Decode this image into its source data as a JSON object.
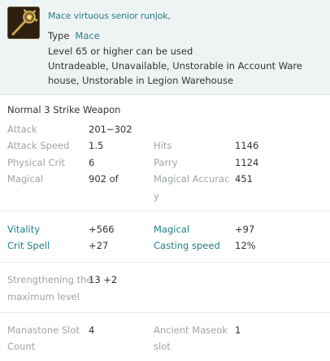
{
  "item": {
    "name": "Mace virtuous senior runjok,",
    "icon": "mace-icon",
    "type_label": "Type",
    "type_value": "Mace",
    "level_req": "Level 65 or higher can be used",
    "restrictions_line1": "Untradeable, Unavailable, Unstorable in Account Ware",
    "restrictions_line2": "house, Unstorable in Legion Warehouse"
  },
  "weapon_type": "Normal 3 Strike Weapon",
  "base_stats": {
    "attack": {
      "label": "Attack",
      "value": "201~302"
    },
    "attack_speed": {
      "label": "Attack Speed",
      "value": "1.5"
    },
    "hits": {
      "label": "Hits",
      "value": "1146"
    },
    "physical_crit": {
      "label": "Physical Crit",
      "value": "6"
    },
    "parry": {
      "label": "Parry",
      "value": "1124"
    },
    "magical": {
      "label": "Magical",
      "value": "902 of"
    },
    "magical_accuracy": {
      "label_line1": "Magical Accurac",
      "label_line2": "y",
      "value": "451"
    }
  },
  "bonus_stats": {
    "vitality": {
      "label": "Vitality",
      "value": "+566"
    },
    "magical": {
      "label": "Magical",
      "value": "+97"
    },
    "crit_spell": {
      "label": "Crit Spell",
      "value": "+27"
    },
    "casting_speed": {
      "label": "Casting speed",
      "value": "12%"
    }
  },
  "enchant": {
    "label_line1": "Strengthening the",
    "label_line2": "maximum level",
    "value": "13 +2"
  },
  "slots": {
    "manastone": {
      "label_line1": "Manastone Slot",
      "label_line2": "Count",
      "value": "4"
    },
    "ancient": {
      "label_line1": "Ancient Maseok",
      "label_line2": "slot",
      "value": "1"
    }
  },
  "colors": {
    "accent": "#2a7f8c",
    "muted_label": "#9ea5a5",
    "header_bg": "#eef3f3"
  }
}
